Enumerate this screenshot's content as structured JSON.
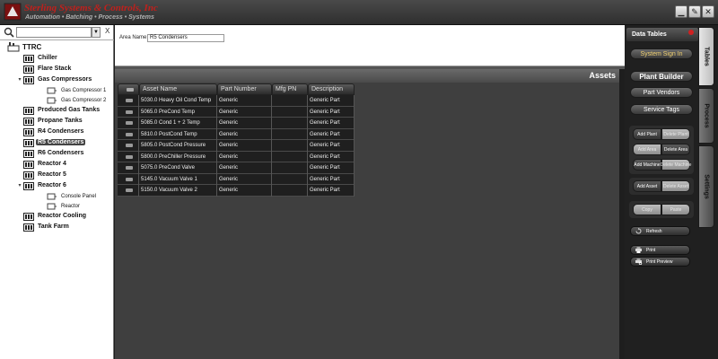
{
  "header": {
    "brand_name": "Sterling Systems & Controls, Inc",
    "tagline": "Automation • Batching • Process • Systems",
    "window_buttons": [
      "minimize",
      "settings",
      "close"
    ]
  },
  "sidebar": {
    "search": {
      "value": "",
      "clear_label": "X"
    },
    "root": "TTRC",
    "nodes": [
      {
        "label": "Chiller"
      },
      {
        "label": "Flare Stack"
      },
      {
        "label": "Gas Compressors",
        "expanded": true,
        "children": [
          "Gas Compressor 1",
          "Gas Compressor 2"
        ]
      },
      {
        "label": "Produced Gas Tanks"
      },
      {
        "label": "Propane Tanks"
      },
      {
        "label": "R4 Condensers"
      },
      {
        "label": "R5 Condensers",
        "selected": true
      },
      {
        "label": "R6 Condensers"
      },
      {
        "label": "Reactor 4"
      },
      {
        "label": "Reactor 5"
      },
      {
        "label": "Reactor 6",
        "expanded": true,
        "children": [
          "Console Panel",
          "Reactor"
        ]
      },
      {
        "label": "Reactor Cooling"
      },
      {
        "label": "Tank Farm"
      }
    ]
  },
  "area": {
    "label": "Area Name:",
    "value": "R5 Condensers"
  },
  "assets": {
    "title": "Assets",
    "columns": [
      "Asset Name",
      "Part Number",
      "Mfg PN",
      "Description"
    ],
    "rows": [
      [
        "5030.0 Heavy Oil Cond Temp",
        "Generic",
        "",
        "Generic Part"
      ],
      [
        "5065.0 PreCond Temp",
        "Generic",
        "",
        "Generic Part"
      ],
      [
        "5085.0 Cond 1 + 2 Temp",
        "Generic",
        "",
        "Generic Part"
      ],
      [
        "5810.0 PostCond Temp",
        "Generic",
        "",
        "Generic Part"
      ],
      [
        "5805.0 PostCond Pressure",
        "Generic",
        "",
        "Generic Part"
      ],
      [
        "5800.0 PreChiller Pressure",
        "Generic",
        "",
        "Generic Part"
      ],
      [
        "5075.0 PreCond Valve",
        "Generic",
        "",
        "Generic Part"
      ],
      [
        "5145.0 Vacuum Valve 1",
        "Generic",
        "",
        "Generic Part"
      ],
      [
        "5150.0 Vacuum Valve 2",
        "Generic",
        "",
        "Generic Part"
      ]
    ]
  },
  "right_panel": {
    "data_tables": "Data Tables",
    "system_sign_in": "System Sign In",
    "plant_builder": "Plant Builder",
    "part_vendors": "Part Vendors",
    "service_tags": "Service Tags",
    "edit_group": {
      "add_plant": "Add Plant",
      "delete_plant": "Delete Plant",
      "add_area": "Add Area",
      "delete_area": "Delete Area",
      "add_machine": "Add Machine",
      "delete_machine": "Delete Machine"
    },
    "asset_group": {
      "add_asset": "Add Asset",
      "delete_asset": "Delete Asset"
    },
    "clip_group": {
      "copy": "Copy",
      "paste": "Paste"
    },
    "refresh": "Refresh",
    "print": "Print",
    "print_preview": "Print Preview",
    "tabs": [
      "Tables",
      "Process",
      "Settings"
    ]
  },
  "colors": {
    "brand_red": "#c0201c",
    "selected_node": "#444444",
    "table_bg": "#1f1f1f",
    "panel_bg": "#3f3f3f",
    "gold_text": "#f0d070"
  }
}
